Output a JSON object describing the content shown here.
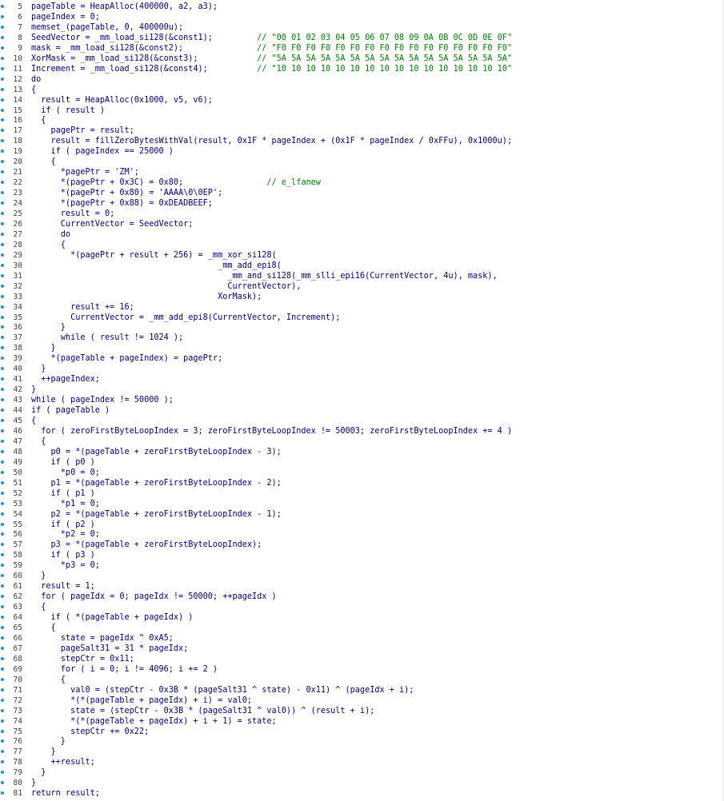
{
  "lines": [
    {
      "n": "5",
      "t": "pageTable = HeapAlloc(400000, a2, a3);"
    },
    {
      "n": "6",
      "t": "pageIndex = 0;"
    },
    {
      "n": "7",
      "t": "memset_(pageTable, 0, 400000u);"
    },
    {
      "n": "8",
      "t": "SeedVector = _mm_load_si128(&const1);         // \"00 01 02 03 04 05 06 07 08 09 0A 0B 0C 0D 0E 0F\""
    },
    {
      "n": "9",
      "t": "mask = _mm_load_si128(&const2);               // \"F0 F0 F0 F0 F0 F0 F0 F0 F0 F0 F0 F0 F0 F0 F0 F0\""
    },
    {
      "n": "10",
      "t": "XorMask = _mm_load_si128(&const3);            // \"5A 5A 5A 5A 5A 5A 5A 5A 5A 5A 5A 5A 5A 5A 5A 5A\""
    },
    {
      "n": "11",
      "t": "Increment = _mm_load_si128(&const4);          // \"10 10 10 10 10 10 10 10 10 10 10 10 10 10 10 10\""
    },
    {
      "n": "12",
      "t": "do"
    },
    {
      "n": "13",
      "t": "{"
    },
    {
      "n": "14",
      "t": "  result = HeapAlloc(0x1000, v5, v6);"
    },
    {
      "n": "15",
      "t": "  if ( result )"
    },
    {
      "n": "16",
      "t": "  {"
    },
    {
      "n": "17",
      "t": "    pagePtr = result;"
    },
    {
      "n": "18",
      "t": "    result = fillZeroBytesWithVal(result, 0x1F * pageIndex + (0x1F * pageIndex / 0xFFu), 0x1000u);"
    },
    {
      "n": "19",
      "t": "    if ( pageIndex == 25000 )"
    },
    {
      "n": "20",
      "t": "    {"
    },
    {
      "n": "21",
      "t": "      *pagePtr = 'ZM';"
    },
    {
      "n": "22",
      "t": "      *(pagePtr + 0x3C) = 0x80;                 // e_lfanew"
    },
    {
      "n": "23",
      "t": "      *(pagePtr + 0x80) = 'AAAA\\0\\0EP';"
    },
    {
      "n": "24",
      "t": "      *(pagePtr + 0x88) = 0xDEADBEEF;"
    },
    {
      "n": "25",
      "t": "      result = 0;"
    },
    {
      "n": "26",
      "t": "      CurrentVector = SeedVector;"
    },
    {
      "n": "27",
      "t": "      do"
    },
    {
      "n": "28",
      "t": "      {"
    },
    {
      "n": "29",
      "t": "        *(pagePtr + result + 256) = _mm_xor_si128("
    },
    {
      "n": "30",
      "t": "                                      _mm_add_epi8("
    },
    {
      "n": "31",
      "t": "                                        _mm_and_si128(_mm_slli_epi16(CurrentVector, 4u), mask),"
    },
    {
      "n": "32",
      "t": "                                        CurrentVector),"
    },
    {
      "n": "33",
      "t": "                                      XorMask);"
    },
    {
      "n": "34",
      "t": "        result += 16;"
    },
    {
      "n": "35",
      "t": "        CurrentVector = _mm_add_epi8(CurrentVector, Increment);"
    },
    {
      "n": "36",
      "t": "      }"
    },
    {
      "n": "37",
      "t": "      while ( result != 1024 );"
    },
    {
      "n": "38",
      "t": "    }"
    },
    {
      "n": "39",
      "t": "    *(pageTable + pageIndex) = pagePtr;"
    },
    {
      "n": "40",
      "t": "  }"
    },
    {
      "n": "41",
      "t": "  ++pageIndex;"
    },
    {
      "n": "42",
      "t": "}"
    },
    {
      "n": "43",
      "t": "while ( pageIndex != 50000 );"
    },
    {
      "n": "44",
      "t": "if ( pageTable )"
    },
    {
      "n": "45",
      "t": "{"
    },
    {
      "n": "46",
      "t": "  for ( zeroFirstByteLoopIndex = 3; zeroFirstByteLoopIndex != 50003; zeroFirstByteLoopIndex += 4 )"
    },
    {
      "n": "47",
      "t": "  {"
    },
    {
      "n": "48",
      "t": "    p0 = *(pageTable + zeroFirstByteLoopIndex - 3);"
    },
    {
      "n": "49",
      "t": "    if ( p0 )"
    },
    {
      "n": "50",
      "t": "      *p0 = 0;"
    },
    {
      "n": "51",
      "t": "    p1 = *(pageTable + zeroFirstByteLoopIndex - 2);"
    },
    {
      "n": "52",
      "t": "    if ( p1 )"
    },
    {
      "n": "53",
      "t": "      *p1 = 0;"
    },
    {
      "n": "54",
      "t": "    p2 = *(pageTable + zeroFirstByteLoopIndex - 1);"
    },
    {
      "n": "55",
      "t": "    if ( p2 )"
    },
    {
      "n": "56",
      "t": "      *p2 = 0;"
    },
    {
      "n": "57",
      "t": "    p3 = *(pageTable + zeroFirstByteLoopIndex);"
    },
    {
      "n": "58",
      "t": "    if ( p3 )"
    },
    {
      "n": "59",
      "t": "      *p3 = 0;"
    },
    {
      "n": "60",
      "t": "  }"
    },
    {
      "n": "61",
      "t": "  result = 1;"
    },
    {
      "n": "62",
      "t": "  for ( pageIdx = 0; pageIdx != 50000; ++pageIdx )"
    },
    {
      "n": "63",
      "t": "  {"
    },
    {
      "n": "64",
      "t": "    if ( *(pageTable + pageIdx) )"
    },
    {
      "n": "65",
      "t": "    {"
    },
    {
      "n": "66",
      "t": "      state = pageIdx ^ 0xA5;"
    },
    {
      "n": "67",
      "t": "      pageSalt31 = 31 * pageIdx;"
    },
    {
      "n": "68",
      "t": "      stepCtr = 0x11;"
    },
    {
      "n": "69",
      "t": "      for ( i = 0; i != 4096; i += 2 )"
    },
    {
      "n": "70",
      "t": "      {"
    },
    {
      "n": "71",
      "t": "        val0 = (stepCtr - 0x3B * (pageSalt31 ^ state) - 0x11) ^ (pageIdx + i);"
    },
    {
      "n": "72",
      "t": "        *(*(pageTable + pageIdx) + i) = val0;"
    },
    {
      "n": "73",
      "t": "        state = (stepCtr - 0x3B * (pageSalt31 ^ val0)) ^ (result + i);"
    },
    {
      "n": "74",
      "t": "        *(*(pageTable + pageIdx) + i + 1) = state;"
    },
    {
      "n": "75",
      "t": "        stepCtr += 0x22;"
    },
    {
      "n": "76",
      "t": "      }"
    },
    {
      "n": "77",
      "t": "    }"
    },
    {
      "n": "78",
      "t": "    ++result;"
    },
    {
      "n": "79",
      "t": "  }"
    },
    {
      "n": "80",
      "t": "}"
    },
    {
      "n": "81",
      "t": "return result;"
    }
  ],
  "colors": {
    "background": "#ffffff",
    "code": "#000080",
    "string_comment": "#008000",
    "variable": "#5050a8",
    "breakpoint_dot": "#2f8fd6"
  }
}
